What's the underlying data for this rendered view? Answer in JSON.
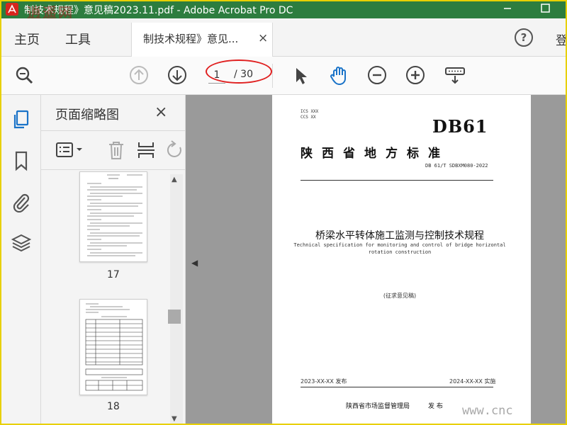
{
  "window": {
    "title": "制技术规程》意见稿2023.11.pdf - Adobe Acrobat Pro DC",
    "watermark_top": "逍遥网",
    "watermark_bottom": "www.cnc"
  },
  "menu": {
    "home": "主页",
    "tools": "工具",
    "doc_tab_label": "制技术规程》意见...",
    "doc_tab_close": "×",
    "help": "?",
    "login": "登"
  },
  "toolbar": {
    "current_page": "1",
    "total_pages": "/ 30"
  },
  "thumbnail_panel": {
    "title": "页面缩略图",
    "close": "×",
    "thumbnails": [
      {
        "label": "17"
      },
      {
        "label": "18"
      }
    ]
  },
  "document": {
    "ics": "ICS XXX",
    "ccs": "CCS XX",
    "standard_code": "DB61",
    "province_standard": "陕西省地方标准",
    "standard_number": "DB 61/T SDBXM080-2022",
    "title_cn": "桥梁水平转体施工监测与控制技术规程",
    "title_en_line1": "Technical specification for monitoring and control of bridge horizontal",
    "title_en_line2": "rotation construction",
    "draft_note": "(征求意见稿)",
    "issue_date": "2023-XX-XX 发布",
    "effective_date": "2024-XX-XX 实施",
    "issuer": "陕西省市场监督管理局",
    "issue_word": "发 布"
  },
  "colors": {
    "titlebar": "#2d7d3f",
    "accent_blue": "#1a73c8",
    "annotation_red": "#e02020"
  }
}
